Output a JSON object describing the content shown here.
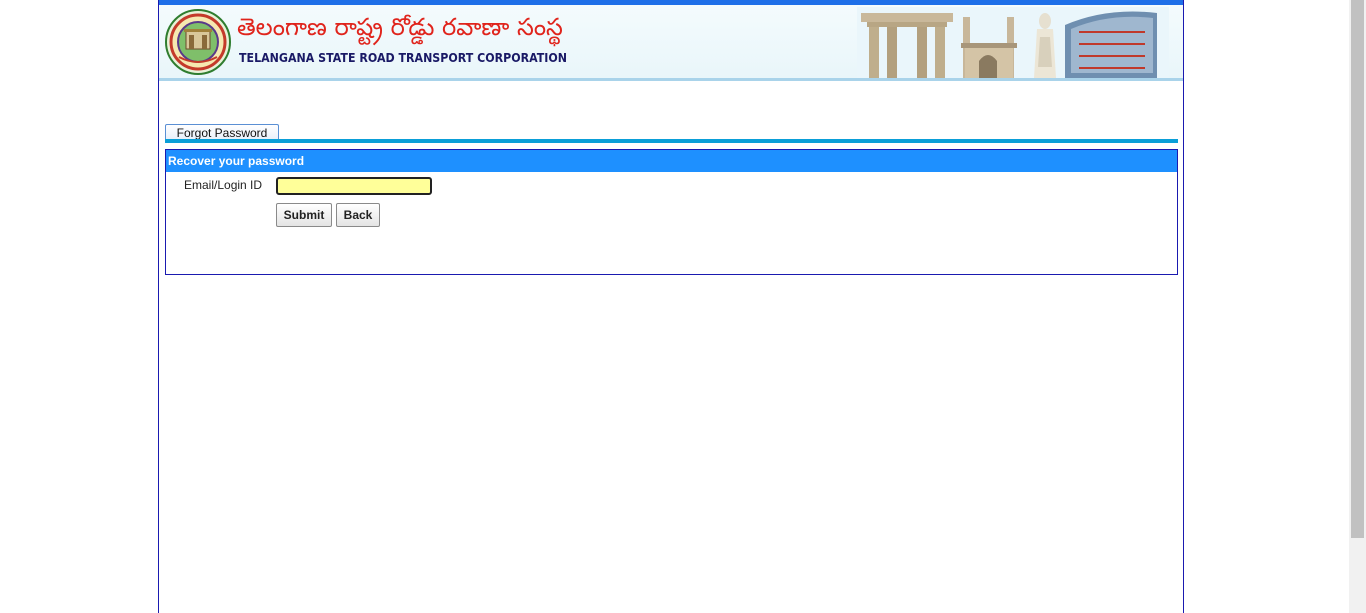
{
  "header": {
    "title_telugu": "తెలంగాణ రాష్ట్ర రోడ్డు రవాణా సంస్థ",
    "title_english": "TELANGANA STATE ROAD TRANSPORT CORPORATION",
    "logo_icon": "tsrtc-logo-icon",
    "banner_icon": "monuments-banner-icon"
  },
  "tab": {
    "label": "Forgot Password"
  },
  "panel": {
    "heading": "Recover your password",
    "email_label": "Email/Login ID",
    "email_value": "",
    "submit_label": "Submit",
    "back_label": "Back"
  },
  "colors": {
    "topbar": "#1e6fe8",
    "panel_head": "#1e90ff",
    "tabline": "#0a9fd8",
    "input_bg": "#ffff99",
    "title_telugu": "#e0241c",
    "title_english": "#1a1a66",
    "border": "#1a1ab0"
  }
}
